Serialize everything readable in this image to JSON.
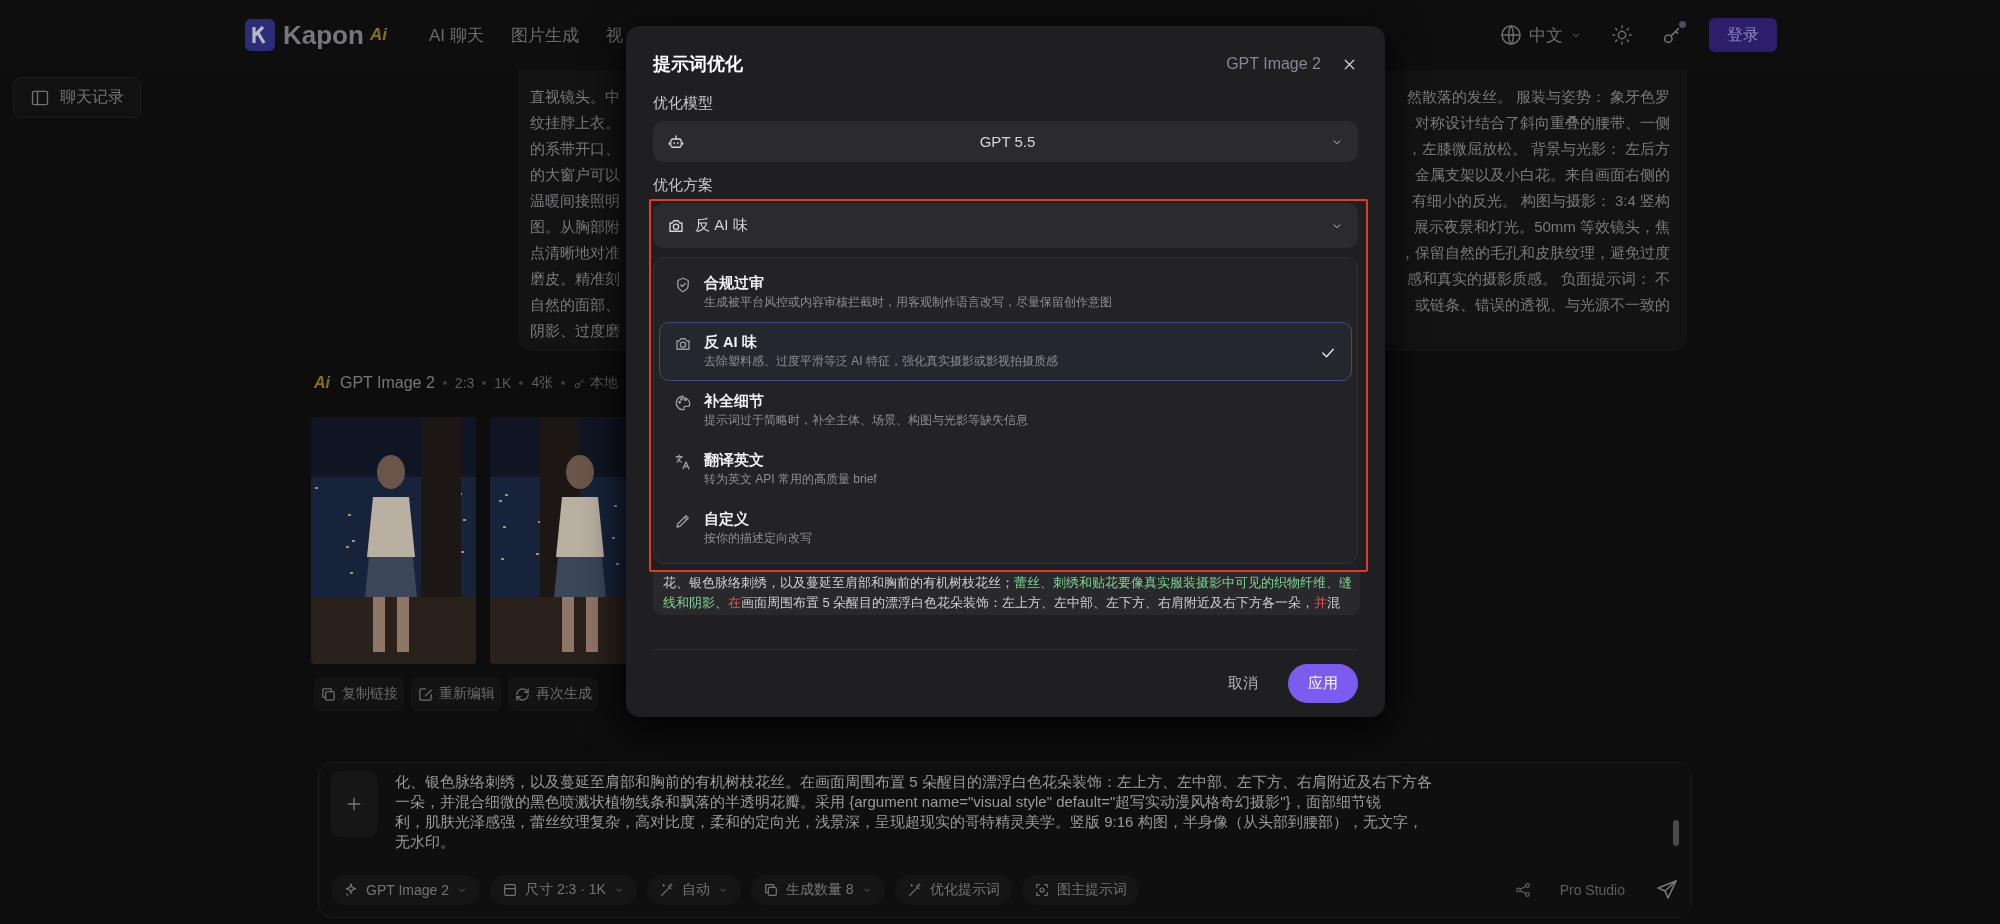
{
  "header": {
    "brand": "Kapon",
    "brand_badge": "Ai",
    "nav": [
      {
        "label": "AI 聊天"
      },
      {
        "label": "图片生成"
      },
      {
        "label": "视"
      }
    ],
    "language": "中文",
    "login": "登录"
  },
  "sidebar": {
    "history_button": "聊天记录"
  },
  "prompt_bubble": {
    "rows": [
      {
        "left": "直视镜头。中",
        "right": "然散落的发丝。 服装与姿势： 象牙色罗"
      },
      {
        "left": "纹挂脖上衣。",
        "right": "对称设计结合了斜向重叠的腰带、一侧"
      },
      {
        "left": "的系带开口、",
        "right": "，左膝微屈放松。 背景与光影： 左后方"
      },
      {
        "left": "的大窗户可以",
        "right": "金属支架以及小白花。来自画面右侧的"
      },
      {
        "left": "温暖间接照明",
        "right": "有细小的反光。 构图与摄影： 3:4 竖构"
      },
      {
        "left": "图。从胸部附",
        "right": "展示夜景和灯光。50mm 等效镜头，焦"
      },
      {
        "left": "点清晰地对准",
        "right": "，保留自然的毛孔和皮肤纹理，避免过度"
      },
      {
        "left": "磨皮。精准刻",
        "right": "感和真实的摄影质感。 负面提示词： 不"
      },
      {
        "left": "自然的面部、",
        "right": "或链条、错误的透视、与光源不一致的"
      },
      {
        "left": "阴影、过度磨"
      }
    ]
  },
  "result": {
    "badge": "Ai",
    "meta": [
      "GPT Image 2",
      "2:3",
      "1K",
      "4张"
    ],
    "source": "本地",
    "images": [
      {
        "kind": "picture"
      },
      {
        "kind": "picture"
      }
    ],
    "actions": [
      {
        "kind": "copy",
        "label": "复制链接"
      },
      {
        "kind": "edit",
        "label": "重新编辑"
      },
      {
        "kind": "regenerate",
        "label": "再次生成"
      }
    ]
  },
  "composer": {
    "lines": [
      "化、银色脉络刺绣，以及蔓延至肩部和胸前的有机树枝花丝。在画面周围布置 5 朵醒目的漂浮白色花朵装饰：左上方、左中部、左下方、右肩附近及右下方各",
      "一朵，并混合细微的黑色喷溅状植物线条和飘落的半透明花瓣。采用 {argument name=\"visual style\" default=\"超写实动漫风格奇幻摄影\"}，面部细节锐",
      "利，肌肤光泽感强，蕾丝纹理复杂，高对比度，柔和的定向光，浅景深，呈现超现实的哥特精灵美学。竖版 9:16 构图，半身像（从头部到腰部），无文字，",
      "无水印。"
    ],
    "toolbar": [
      {
        "kind": "model",
        "label": "GPT Image 2",
        "dropdown": true
      },
      {
        "kind": "size",
        "label": "尺寸 2:3 · 1K",
        "dropdown": true
      },
      {
        "kind": "auto",
        "label": "自动",
        "dropdown": true
      },
      {
        "kind": "count",
        "label": "生成数量 8",
        "dropdown": true
      },
      {
        "kind": "optimize",
        "label": "优化提示词",
        "dropdown": false
      },
      {
        "kind": "image_prompt",
        "label": "图主提示词",
        "dropdown": false
      }
    ],
    "studio": "Pro Studio"
  },
  "dialog": {
    "title": "提示词优化",
    "model_tag": "GPT Image 2",
    "model_label": "优化模型",
    "model_select": {
      "value": "GPT 5.5"
    },
    "scheme_label": "优化方案",
    "scheme": {
      "highlighted": true,
      "value": "反 AI 味",
      "kind": "camera",
      "expanded": true
    },
    "options": [
      {
        "kind": "shield",
        "title": "合规过审",
        "description": "生成被平台风控或内容审核拦截时，用客观制作语言改写，尽量保留创作意图",
        "selected": false
      },
      {
        "kind": "camera",
        "title": "反 AI 味",
        "description": "去除塑料感、过度平滑等泛 AI 特征，强化真实摄影或影视拍摄质感",
        "selected": true
      },
      {
        "kind": "palette",
        "title": "补全细节",
        "description": "提示词过于简略时，补全主体、场景、构图与光影等缺失信息",
        "selected": false
      },
      {
        "kind": "translate",
        "title": "翻译英文",
        "description": "转为英文 API 常用的高质量 brief",
        "selected": false
      },
      {
        "kind": "pencil",
        "title": "自定义",
        "description": "按你的描述定向改写",
        "selected": false
      }
    ],
    "preview_lines": [
      [
        {
          "text": "花、银色脉络刺绣，以及蔓延至肩部和胸前的有机树枝花丝；",
          "kind": "plain"
        },
        {
          "text": "蕾丝、刺绣和贴花要像真实服装摄影中可见的织物纤维、缝",
          "kind": "added"
        }
      ],
      [
        {
          "text": "线和阴影",
          "kind": "added"
        },
        {
          "text": "、",
          "kind": "plain"
        },
        {
          "text": "在",
          "kind": "flagged"
        },
        {
          "text": "画面周围布置 5 朵醒目的漂浮白色花朵装饰：左上方、左中部、左下方、右肩附近及右下方各一朵，",
          "kind": "plain"
        },
        {
          "text": "并",
          "kind": "flagged"
        },
        {
          "text": "混",
          "kind": "plain"
        }
      ]
    ],
    "cancel": "取消",
    "apply": "应用"
  }
}
